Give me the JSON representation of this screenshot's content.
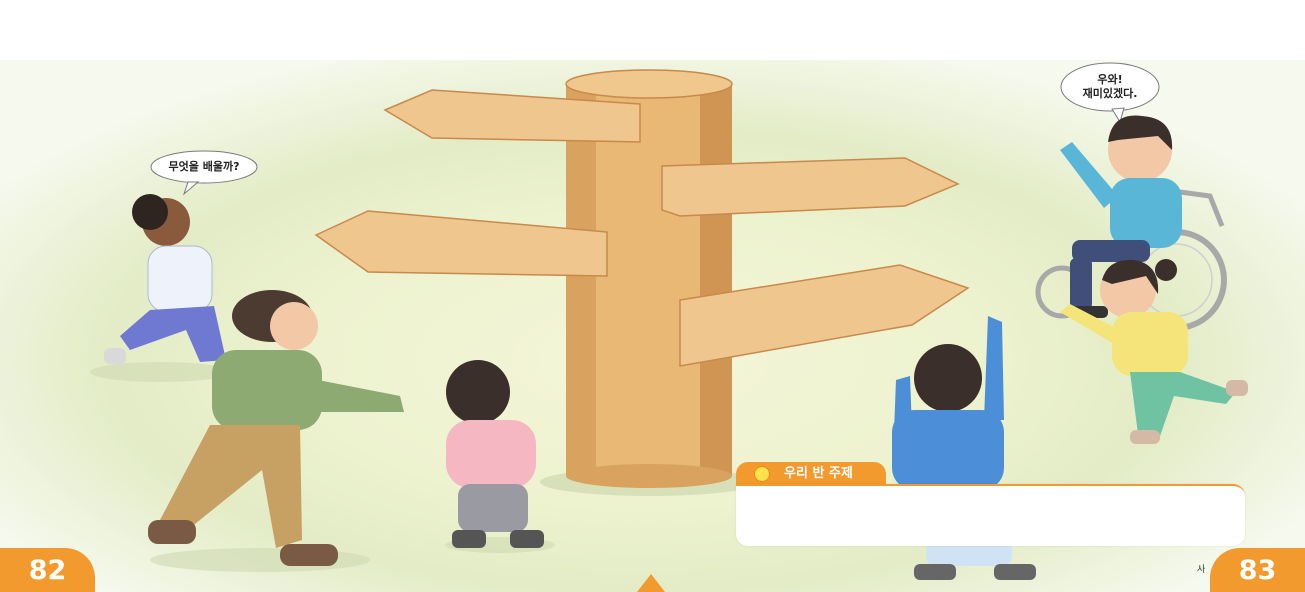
{
  "bubbles": {
    "left": "무엇을 배울까?",
    "right_line1": "우와!",
    "right_line2": "재미있겠다."
  },
  "theme_box": {
    "title": "우리 반 주제",
    "value": ""
  },
  "page_numbers": {
    "left": "82",
    "right": "83"
  },
  "footer_partial": "사",
  "colors": {
    "accent": "#f29a2e",
    "wood": "#e8b874",
    "ground": "#edf2cf"
  }
}
